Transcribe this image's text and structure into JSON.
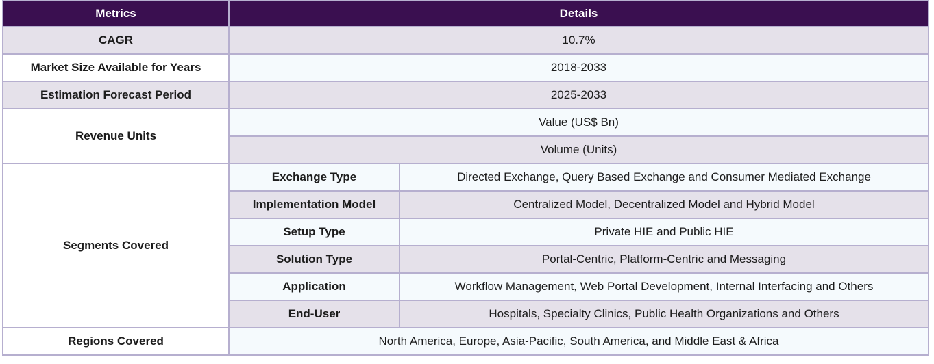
{
  "header": {
    "metrics": "Metrics",
    "details": "Details"
  },
  "rows": {
    "cagr": {
      "label": "CAGR",
      "value": "10.7%"
    },
    "market_size": {
      "label": "Market Size Available for Years",
      "value": "2018-2033"
    },
    "forecast": {
      "label": "Estimation Forecast Period",
      "value": "2025-2033"
    },
    "revenue": {
      "label": "Revenue Units",
      "values": [
        "Value (US$ Bn)",
        "Volume (Units)"
      ]
    },
    "segments": {
      "label": "Segments Covered",
      "items": [
        {
          "name": "Exchange Type",
          "value": "Directed Exchange, Query Based Exchange and Consumer Mediated Exchange"
        },
        {
          "name": "Implementation Model",
          "value": "Centralized Model, Decentralized Model and Hybrid Model"
        },
        {
          "name": "Setup Type",
          "value": "Private HIE and Public HIE"
        },
        {
          "name": "Solution Type",
          "value": "Portal-Centric, Platform-Centric and Messaging"
        },
        {
          "name": "Application",
          "value": "Workflow Management, Web Portal Development, Internal Interfacing and Others"
        },
        {
          "name": "End-User",
          "value": "Hospitals, Specialty Clinics, Public Health Organizations and Others"
        }
      ]
    },
    "regions": {
      "label": "Regions Covered",
      "value": "North America, Europe, Asia-Pacific, South America, and Middle East & Africa"
    }
  },
  "colors": {
    "header_bg": "#3a0f50",
    "row_shade": "#e5e1ea",
    "row_light": "#f5fafd",
    "border": "#b6afcf"
  }
}
